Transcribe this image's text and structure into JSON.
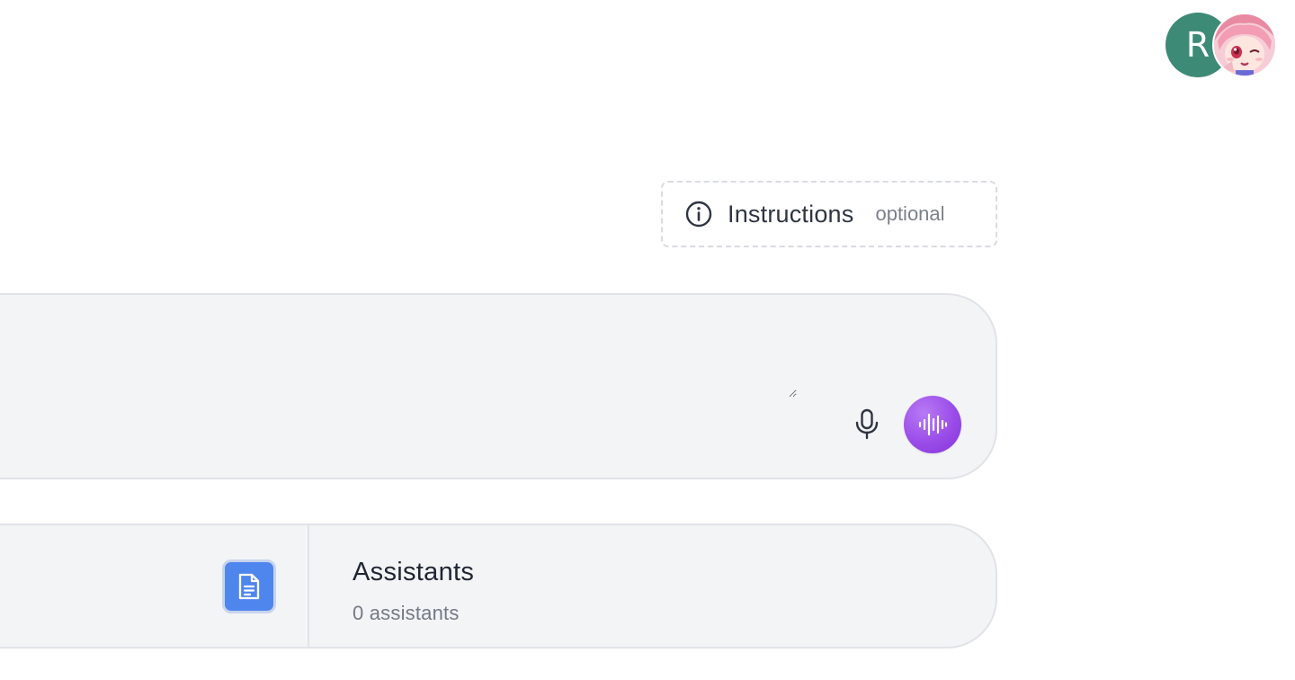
{
  "header": {
    "user_initial": "R",
    "avatar_color": "#3d8a76"
  },
  "instructions": {
    "label": "Instructions",
    "optional_label": "optional",
    "icon": "info-icon"
  },
  "prompt": {
    "value": "",
    "mic_icon": "microphone-icon",
    "voice_icon": "soundwave-icon",
    "voice_button_color": "#9a4ce8"
  },
  "cards": {
    "document_icon": "document-icon",
    "document_tile_color": "#4f86ee",
    "assistants": {
      "title": "Assistants",
      "count_text": "0 assistants"
    }
  }
}
